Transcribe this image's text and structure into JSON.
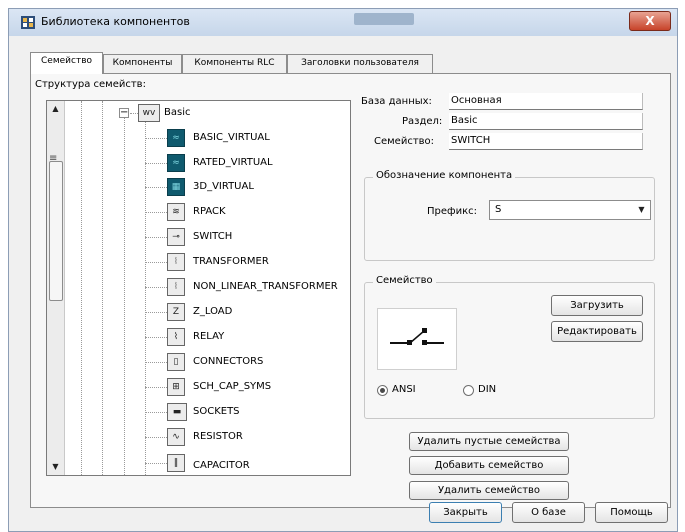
{
  "window": {
    "title": "Библиотека компонентов",
    "close_label": "X"
  },
  "tabs": [
    {
      "label": "Семейство",
      "active": true
    },
    {
      "label": "Компоненты",
      "active": false
    },
    {
      "label": "Компоненты RLC",
      "active": false
    },
    {
      "label": "Заголовки пользователя",
      "active": false
    }
  ],
  "tree": {
    "label": "Структура семейств:",
    "root": {
      "label": "Basic",
      "icon": "basic-chip-icon",
      "expander": "−"
    },
    "items": [
      {
        "label": "BASIC_VIRTUAL",
        "icon": "basic-virtual-icon"
      },
      {
        "label": "RATED_VIRTUAL",
        "icon": "rated-virtual-icon"
      },
      {
        "label": "3D_VIRTUAL",
        "icon": "3d-virtual-icon"
      },
      {
        "label": "RPACK",
        "icon": "rpack-icon"
      },
      {
        "label": "SWITCH",
        "icon": "switch-icon"
      },
      {
        "label": "TRANSFORMER",
        "icon": "transformer-icon"
      },
      {
        "label": "NON_LINEAR_TRANSFORMER",
        "icon": "nonlinear-transformer-icon"
      },
      {
        "label": "Z_LOAD",
        "icon": "z-load-icon"
      },
      {
        "label": "RELAY",
        "icon": "relay-icon"
      },
      {
        "label": "CONNECTORS",
        "icon": "connectors-icon"
      },
      {
        "label": "SCH_CAP_SYMS",
        "icon": "sch-cap-syms-icon"
      },
      {
        "label": "SOCKETS",
        "icon": "sockets-icon"
      },
      {
        "label": "RESISTOR",
        "icon": "resistor-icon"
      },
      {
        "label": "CAPACITOR",
        "icon": "capacitor-icon"
      }
    ]
  },
  "info": {
    "database_label": "База данных:",
    "database_value": "Основная",
    "section_label": "Раздел:",
    "section_value": "Basic",
    "family_label": "Семейство:",
    "family_value": "SWITCH"
  },
  "designation": {
    "group_title": "Обозначение компонента",
    "prefix_label": "Префикс:",
    "prefix_value": "S"
  },
  "family_group": {
    "title": "Семейство",
    "load_button": "Загрузить",
    "edit_button": "Редактировать",
    "radio_ansi": "ANSI",
    "radio_din": "DIN",
    "selected": "ANSI"
  },
  "actions": {
    "delete_empty": "Удалить пустые семейства",
    "add_family": "Добавить семейство",
    "delete_family": "Удалить семейство"
  },
  "footer": {
    "close": "Закрыть",
    "about": "О базе",
    "help": "Помощь"
  }
}
